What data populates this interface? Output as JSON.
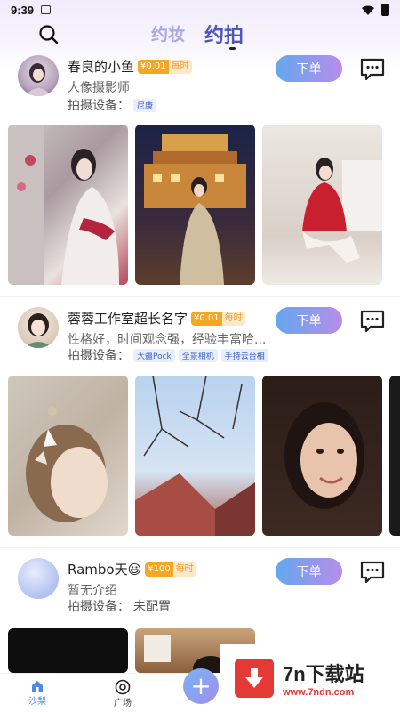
{
  "status_bar": {
    "time": "9:39"
  },
  "header": {
    "tabs": [
      {
        "label": "约妆",
        "active": false
      },
      {
        "label": "约拍",
        "active": true
      }
    ]
  },
  "photographers": [
    {
      "name": "春良的小鱼",
      "price": "¥0.01",
      "unit": "每时",
      "description": "人像摄影师",
      "equipment_label": "拍摄设备：",
      "equipment_tags": [
        "尼康"
      ],
      "order_label": "下单"
    },
    {
      "name": "蓉蓉工作室超长名字",
      "price": "¥0.01",
      "unit": "每时",
      "description": "性格好，时间观念强，经验丰富哈...",
      "equipment_label": "拍摄设备：",
      "equipment_tags": [
        "大疆Pock",
        "全景相机",
        "手持云台相"
      ],
      "order_label": "下单"
    },
    {
      "name": "Rambo天😃",
      "price": "¥100",
      "unit": "每时",
      "description": "暂无介绍",
      "equipment_label": "拍摄设备：",
      "equipment_value": "未配置",
      "order_label": "下单"
    }
  ],
  "bottom_nav": {
    "items": [
      {
        "label": "沙梨",
        "icon": "home-icon",
        "active": true
      },
      {
        "label": "广场",
        "icon": "target-icon",
        "active": false
      }
    ],
    "add_icon": "+"
  },
  "watermark": {
    "title": "7n下载站",
    "url": "www.7ndn.com"
  },
  "colors": {
    "accent": "#4b56b8",
    "order_gradient_start": "#63a8ee",
    "order_gradient_end": "#b78cea",
    "price": "#f5a623"
  }
}
